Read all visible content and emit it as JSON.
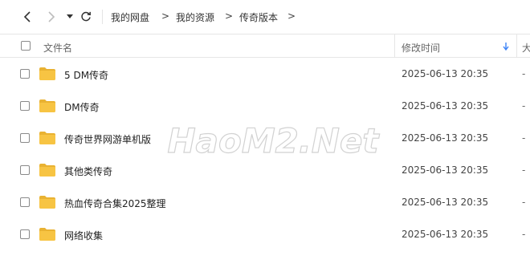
{
  "breadcrumb": [
    "我的网盘",
    "我的资源",
    "传奇版本"
  ],
  "breadcrumb_separator": ">",
  "header": {
    "name": "文件名",
    "modified": "修改时间",
    "size": "大"
  },
  "files": [
    {
      "name": "5 DM传奇",
      "modified": "2025-06-13 20:35",
      "size": "-"
    },
    {
      "name": "DM传奇",
      "modified": "2025-06-13 20:35",
      "size": "-"
    },
    {
      "name": "传奇世界网游单机版",
      "modified": "2025-06-13 20:35",
      "size": "-"
    },
    {
      "name": "其他类传奇",
      "modified": "2025-06-13 20:35",
      "size": "-"
    },
    {
      "name": "热血传奇合集2025整理",
      "modified": "2025-06-13 20:35",
      "size": "-"
    },
    {
      "name": "网络收集",
      "modified": "2025-06-13 20:35",
      "size": "-"
    }
  ],
  "icons": [
    "back-icon",
    "forward-icon",
    "dropdown-icon",
    "refresh-icon",
    "sort-desc-icon",
    "folder-icon"
  ],
  "colors": {
    "folder": "#F7C443",
    "folder_tab": "#E9B232",
    "sort_arrow": "#3b82f6"
  },
  "watermark": "HaoM2.Net"
}
